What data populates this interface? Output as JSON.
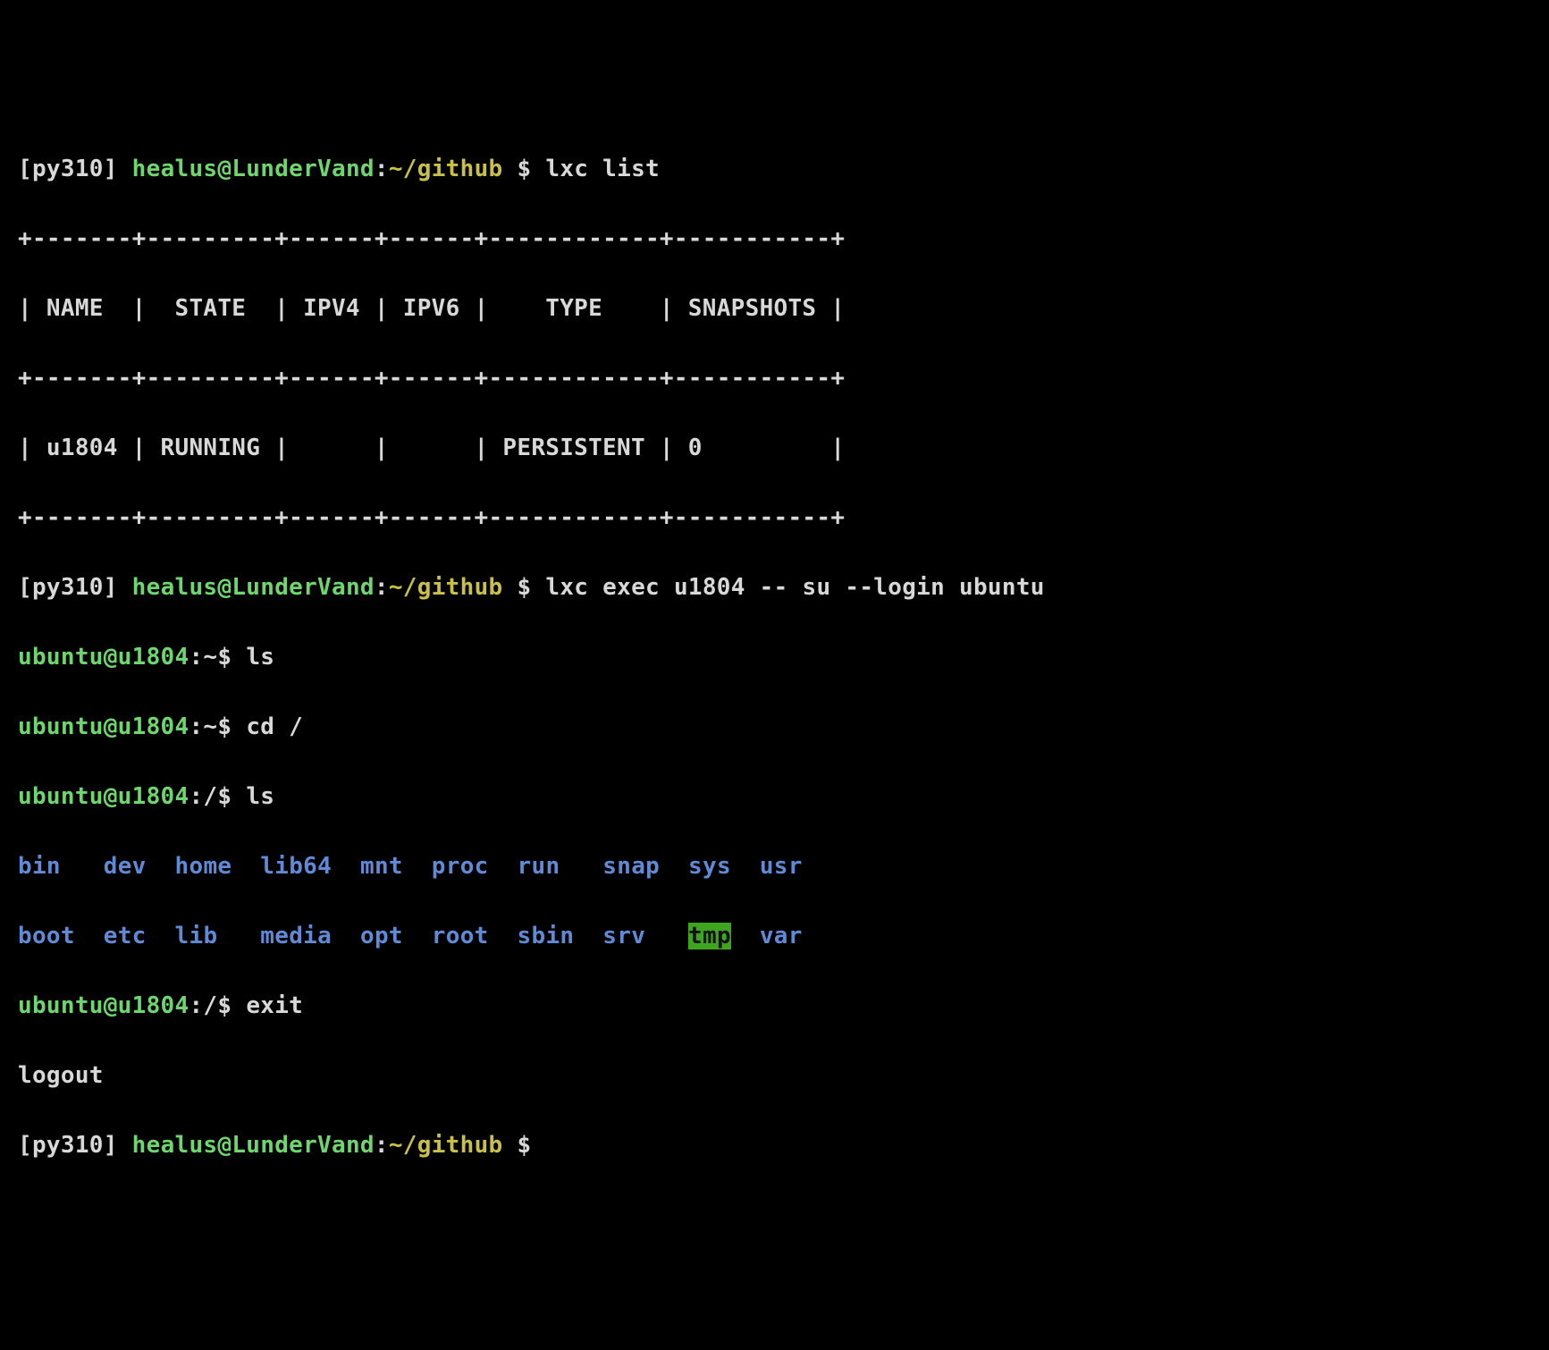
{
  "prompt1": {
    "env": "[py310]",
    "user": "healus@LunderVand",
    "colon": ":",
    "path": "~/github",
    "sigil": " $ ",
    "cmd": "lxc list"
  },
  "table": {
    "border_top": "+-------+---------+------+------+------------+-----------+",
    "header_row": "| NAME  |  STATE  | IPV4 | IPV6 |    TYPE    | SNAPSHOTS |",
    "border_mid": "+-------+---------+------+------+------------+-----------+",
    "data_row": "| u1804 | RUNNING |      |      | PERSISTENT | 0         |",
    "border_bot": "+-------+---------+------+------+------------+-----------+"
  },
  "prompt2": {
    "env": "[py310]",
    "user": "healus@LunderVand",
    "colon": ":",
    "path": "~/github",
    "sigil": " $ ",
    "cmd": "lxc exec u1804 -- su --login ubuntu"
  },
  "nested": {
    "p1_user": "ubuntu@u1804",
    "p1_colon": ":",
    "p1_path": "~",
    "p1_dollar": "$ ",
    "p1_cmd": "ls",
    "p2_user": "ubuntu@u1804",
    "p2_colon": ":",
    "p2_path": "~",
    "p2_dollar": "$ ",
    "p2_cmd": "cd /",
    "p3_user": "ubuntu@u1804",
    "p3_colon": ":",
    "p3_path": "/",
    "p3_dollar": "$ ",
    "p3_cmd": "ls",
    "ls_row1": {
      "a": "bin",
      "a_pad": "   ",
      "b": "dev",
      "b_pad": "  ",
      "c": "home",
      "c_pad": "  ",
      "d": "lib64",
      "d_pad": "  ",
      "e": "mnt",
      "e_pad": "  ",
      "f": "proc",
      "f_pad": "  ",
      "g": "run",
      "g_pad": "   ",
      "h": "snap",
      "h_pad": "  ",
      "i": "sys",
      "i_pad": "  ",
      "j": "usr"
    },
    "ls_row2": {
      "a": "boot",
      "a_pad": "  ",
      "b": "etc",
      "b_pad": "  ",
      "c": "lib",
      "c_pad": "   ",
      "d": "media",
      "d_pad": "  ",
      "e": "opt",
      "e_pad": "  ",
      "f": "root",
      "f_pad": "  ",
      "g": "sbin",
      "g_pad": "  ",
      "h": "srv",
      "h_pad": "   ",
      "i": "tmp",
      "i_pad": "  ",
      "j": "var"
    },
    "p4_user": "ubuntu@u1804",
    "p4_colon": ":",
    "p4_path": "/",
    "p4_dollar": "$ ",
    "p4_cmd": "exit",
    "logout": "logout"
  },
  "prompt3": {
    "env": "[py310]",
    "user": "healus@LunderVand",
    "colon": ":",
    "path": "~/github",
    "sigil": " $"
  }
}
